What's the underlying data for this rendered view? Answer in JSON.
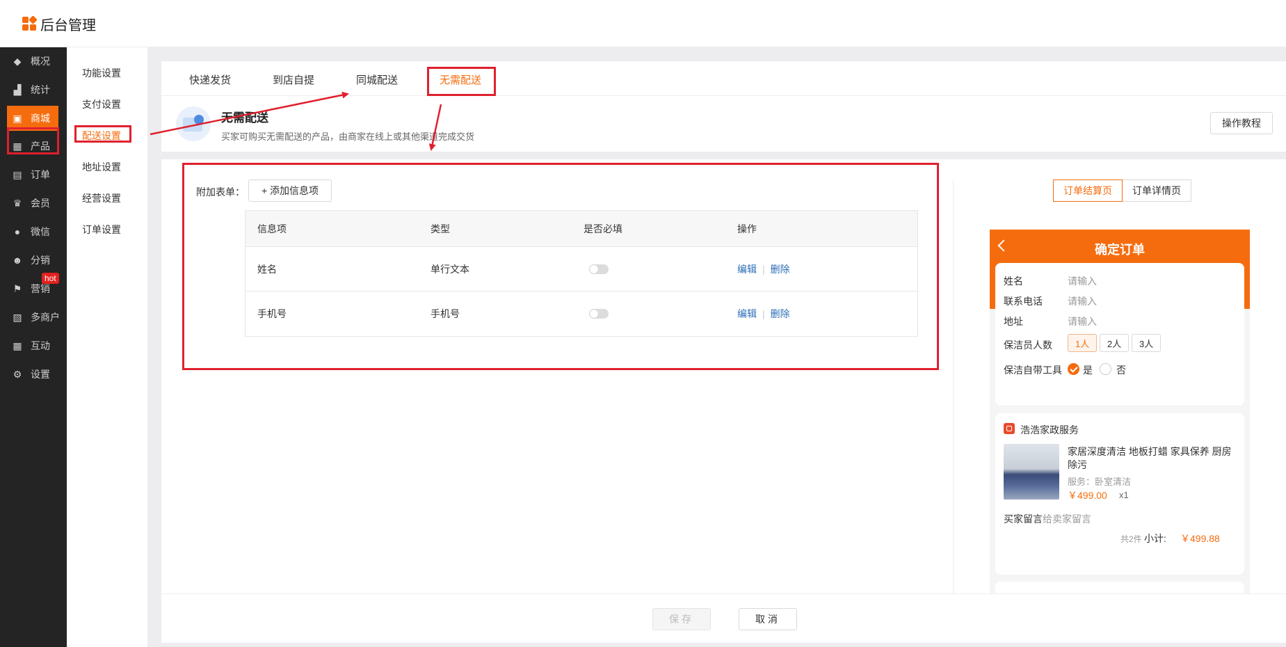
{
  "app": {
    "title": "后台管理"
  },
  "sidebar": {
    "items": [
      {
        "label": "概况",
        "icon": "layers-icon"
      },
      {
        "label": "统计",
        "icon": "chart-icon"
      },
      {
        "label": "商城",
        "icon": "shop-icon"
      },
      {
        "label": "产品",
        "icon": "grid-icon"
      },
      {
        "label": "订单",
        "icon": "clipboard-icon"
      },
      {
        "label": "会员",
        "icon": "crown-icon"
      },
      {
        "label": "微信",
        "icon": "wechat-icon"
      },
      {
        "label": "分销",
        "icon": "user-share-icon"
      },
      {
        "label": "营销",
        "icon": "flag-icon"
      },
      {
        "label": "多商户",
        "icon": "store-icon"
      },
      {
        "label": "互动",
        "icon": "apps-icon"
      },
      {
        "label": "设置",
        "icon": "gear-icon"
      }
    ],
    "hot_badge": "hot",
    "active": "商城",
    "accent_color": "#f56c0e"
  },
  "submenu": {
    "items": [
      "功能设置",
      "支付设置",
      "配送设置",
      "地址设置",
      "经营设置",
      "订单设置"
    ],
    "active": "配送设置"
  },
  "tabs": [
    "快递发货",
    "到店自提",
    "同城配送",
    "无需配送"
  ],
  "active_tab": "无需配送",
  "info": {
    "title": "无需配送",
    "desc": "买家可购买无需配送的产品，由商家在线上或其他渠道完成交货",
    "tutorial_button": "操作教程"
  },
  "form": {
    "label": "附加表单：",
    "add_button": "+ 添加信息项",
    "columns": [
      "信息项",
      "类型",
      "是否必填",
      "操作"
    ],
    "rows": [
      {
        "name": "姓名",
        "type": "单行文本",
        "required": false
      },
      {
        "name": "手机号",
        "type": "手机号",
        "required": false
      }
    ],
    "edit_label": "编辑",
    "delete_label": "删除"
  },
  "preview": {
    "tabs": [
      "订单结算页",
      "订单详情页"
    ],
    "active_tab": "订单结算页",
    "title": "确定订单",
    "fields": [
      {
        "label": "姓名",
        "placeholder": "请输入"
      },
      {
        "label": "联系电话",
        "placeholder": "请输入"
      },
      {
        "label": "地址",
        "placeholder": "请输入"
      }
    ],
    "cleaner_count_label": "保洁员人数",
    "cleaner_options": [
      "1人",
      "2人",
      "3人"
    ],
    "selected_cleaner": "1人",
    "tools_label": "保洁自带工具",
    "tools_yes": "是",
    "tools_no": "否",
    "tools_selected": "是",
    "shop_name": "浩浩家政服务",
    "product_name": "家居深度清洁 地板打蜡 家具保养 厨房除污",
    "product_spec": "服务：卧室清洁",
    "product_price": "￥499.00",
    "product_qty": "x1",
    "message_label": "买家留言",
    "message_placeholder": "给卖家留言",
    "total_count": "共2件",
    "subtotal_label": "小计:",
    "subtotal_value": "￥499.88"
  },
  "footer": {
    "save": "保存",
    "cancel": "取消"
  }
}
